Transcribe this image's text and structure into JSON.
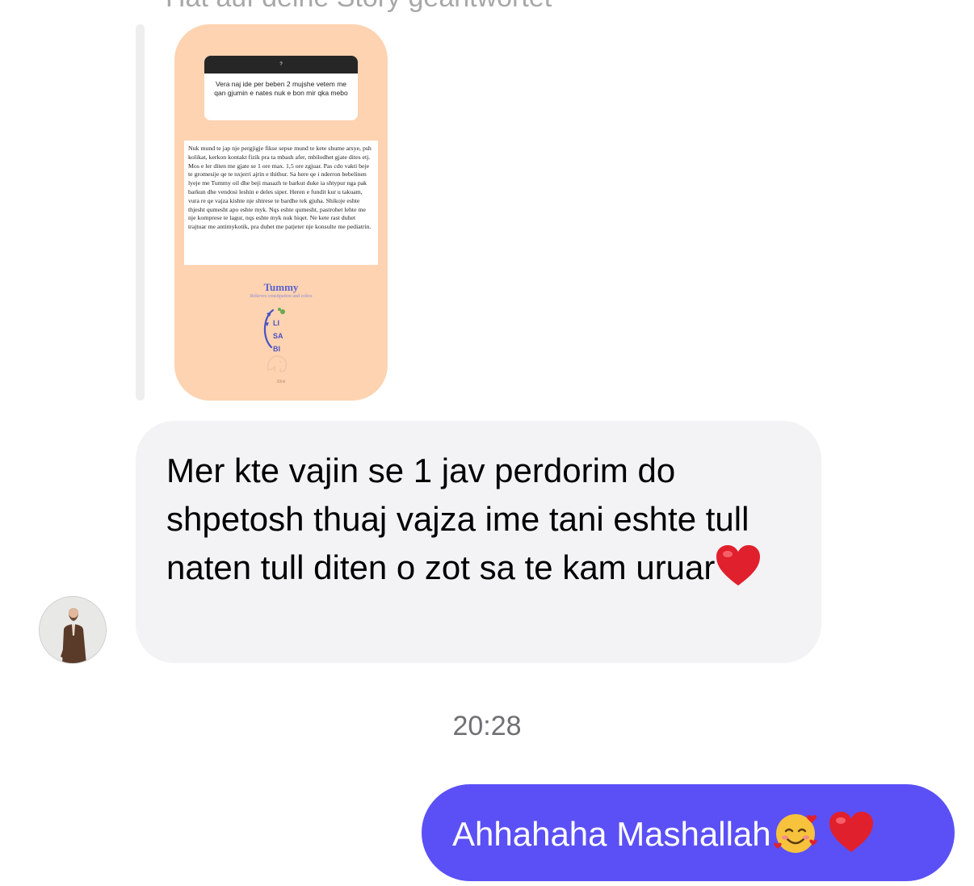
{
  "thread": {
    "reply_header": "Hat auf deine Story geantwortet",
    "story": {
      "question_header": "?",
      "question": "Vera naj ide per beben 2  mujshe  vetem me qan gjumin e nates nuk e  bon mir qka mebo",
      "answer": "Nuk mund te jap nje pergjigje fikse sepse mund te kete shume arsye, psh kolikat, kerkon kontakt fizik pra ta mbash afer, mbilodhet gjate dites etj.\nMos e ler diten me gjate se 1 ore max. 1,5 ore zgjuar. Pas cdo vakti beje te gromesije qe te nxjerri ajrin e thithur. Sa here qe i nderron bebelinen lyeje me Tummy oil dhe beji masazh te barkut duke ia shtypur nga pak barkun dhe vendosi leshin e deles siper. Heren e fundit kur u takuam, vura re qe vajza kishte nje shtrese te bardhe tek gjuha. Shikoje eshte thjesht qumesht apo eshte myk. Nqs eshte qumesht, pastrohet lehte me nje komprese te lagur, nqs eshte myk nuk hiqet. Ne kete rast duhet trajtuar me antimykotik, pra duhet me patjeter nje konsulte me pediatrin.",
      "brand_name": "Tummy",
      "brand_tagline": "Relieves constipation and colics",
      "brand_letters": [
        "LI",
        "SA",
        "BI"
      ],
      "footer": "20ml"
    },
    "incoming_message": "Mer kte vajin se 1 jav perdorim do shpetosh thuaj vajza ime tani eshte tull naten tull diten o zot sa te kam uruar",
    "timestamp": "20:28",
    "outgoing_message": "Ahhahaha Mashallah"
  },
  "colors": {
    "story_bg": "#fed3b1",
    "incoming_bubble": "#f3f3f5",
    "outgoing_bubble": "#5b50f6",
    "heart": "#e0202c"
  },
  "icons": {
    "heart": "red-heart-icon",
    "smiling_face": "smiling-face-with-hearts-icon",
    "avatar": "user-avatar"
  }
}
